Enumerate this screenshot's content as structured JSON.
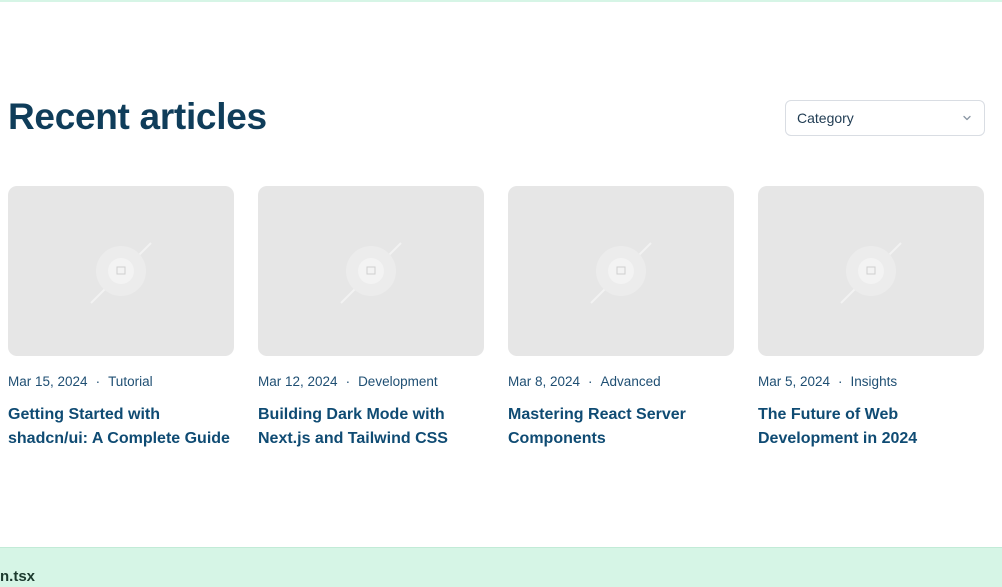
{
  "section": {
    "title": "Recent articles",
    "category_select": {
      "label": "Category"
    }
  },
  "articles": [
    {
      "date": "Mar 15, 2024",
      "category": "Tutorial",
      "title": "Getting Started with shadcn/ui: A Complete Guide"
    },
    {
      "date": "Mar 12, 2024",
      "category": "Development",
      "title": "Building Dark Mode with Next.js and Tailwind CSS"
    },
    {
      "date": "Mar 8, 2024",
      "category": "Advanced",
      "title": "Mastering React Server Components"
    },
    {
      "date": "Mar 5, 2024",
      "category": "Insights",
      "title": "The Future of Web Development in 2024"
    }
  ],
  "meta_separator": "·",
  "bottom_bar": {
    "file_label": "n.tsx"
  },
  "colors": {
    "accent": "#0f3d5a",
    "link": "#0f4b73",
    "bar": "#d6f5e6",
    "placeholder": "#e6e6e6"
  }
}
